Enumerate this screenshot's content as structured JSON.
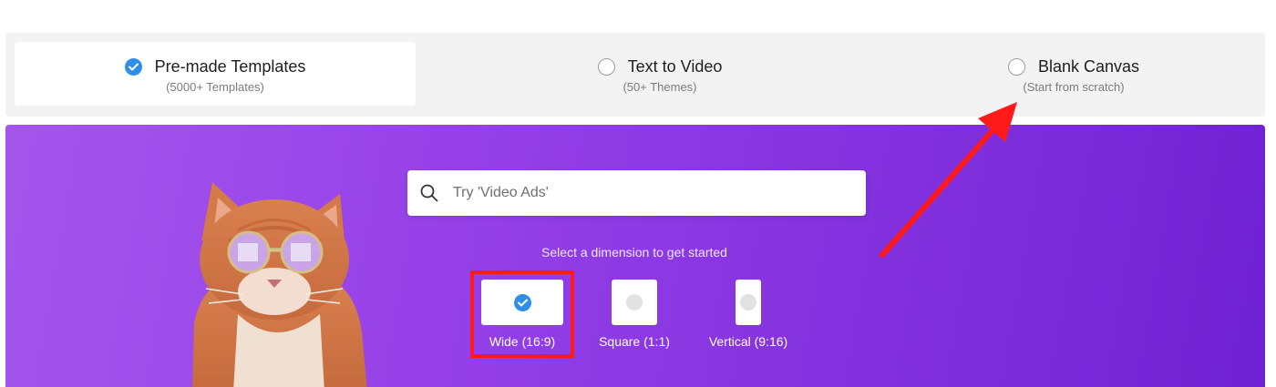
{
  "modes": [
    {
      "title": "Pre-made Templates",
      "subtitle": "(5000+ Templates)",
      "selected": true
    },
    {
      "title": "Text to Video",
      "subtitle": "(50+ Themes)",
      "selected": false
    },
    {
      "title": "Blank Canvas",
      "subtitle": "(Start from scratch)",
      "selected": false
    }
  ],
  "search": {
    "placeholder": "Try 'Video Ads'",
    "icon": "search-icon"
  },
  "hint": "Select a dimension to get started",
  "dimensions": [
    {
      "label": "Wide (16:9)",
      "selected": true
    },
    {
      "label": "Square (1:1)",
      "selected": false
    },
    {
      "label": "Vertical (9:16)",
      "selected": false
    }
  ],
  "colors": {
    "accent": "#2f8ee8",
    "hero_start": "#a456ec",
    "hero_end": "#6f22d2",
    "annotation": "#ff1a1a"
  }
}
